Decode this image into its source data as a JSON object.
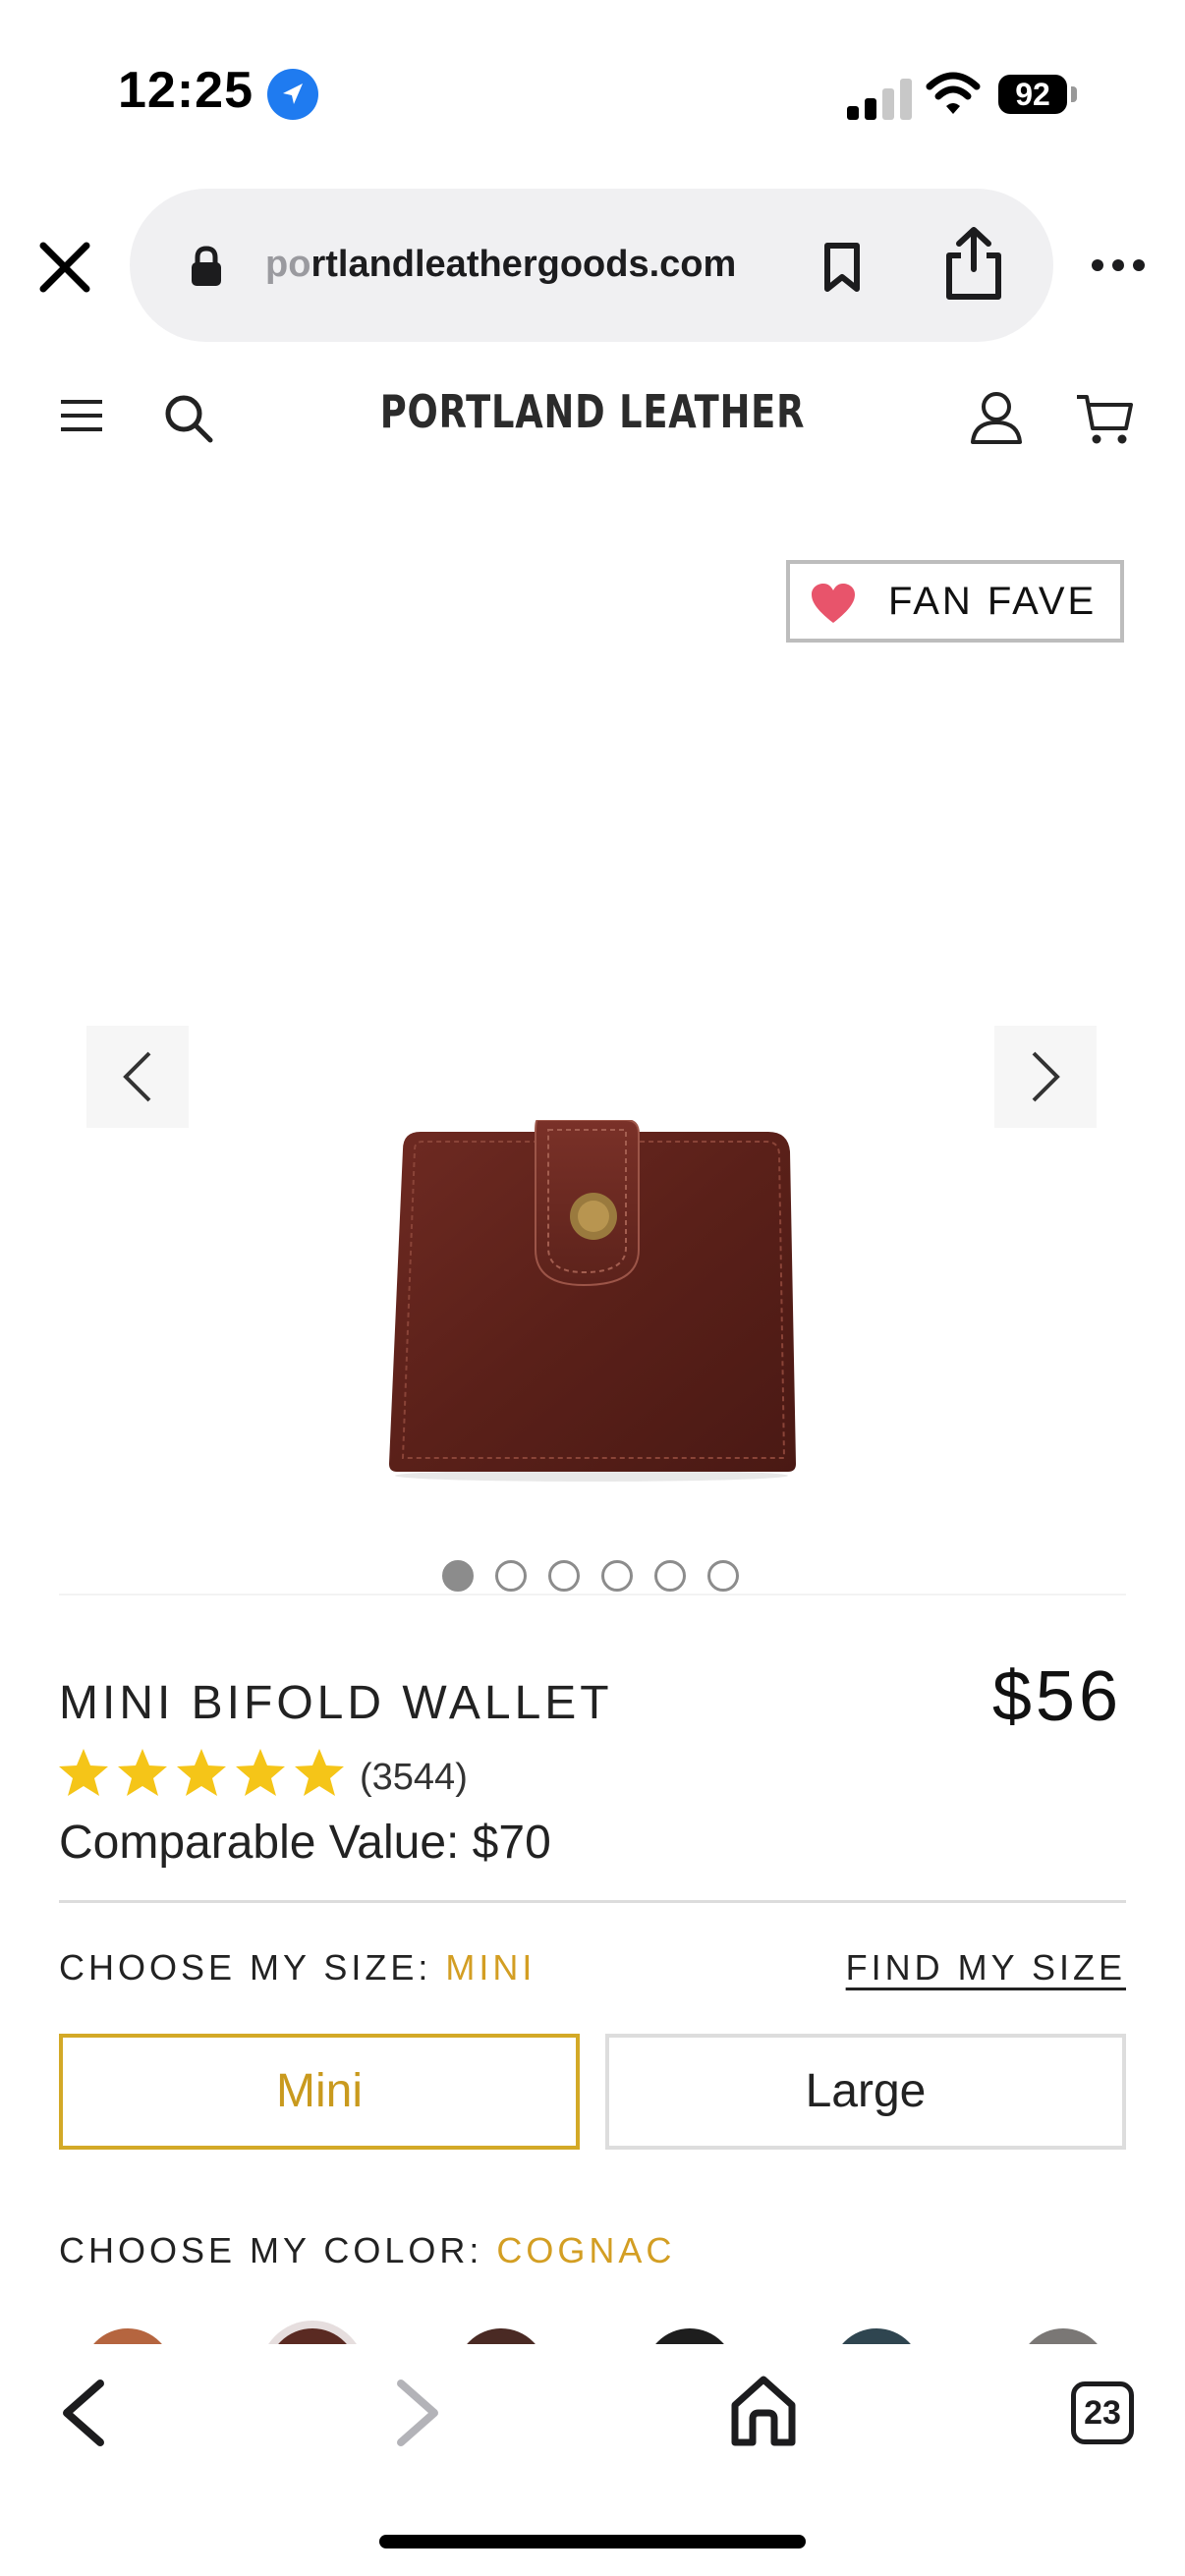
{
  "status_bar": {
    "time": "12:25",
    "battery": "92"
  },
  "browser": {
    "url_faded": "po",
    "url_main": "rtlandleathergoods.com",
    "tab_count": "23"
  },
  "site": {
    "logo": "PORTLAND LEATHER"
  },
  "product": {
    "badge": "FAN FAVE",
    "title": "MINI BIFOLD WALLET",
    "price": "$56",
    "rating_stars": 5,
    "review_count": "(3544)",
    "comparable_value": "Comparable Value: $70",
    "image_page": {
      "current": 1,
      "total": 6
    }
  },
  "size": {
    "label": "CHOOSE MY SIZE:",
    "selected": "MINI",
    "find_link": "FIND MY SIZE",
    "options": [
      "Mini",
      "Large"
    ]
  },
  "color": {
    "label": "CHOOSE MY COLOR:",
    "selected": "COGNAC",
    "swatches": [
      "#b5653f",
      "#5a2a22",
      "#4a2a24",
      "#1e1e1e",
      "#2f4550",
      "#7a7775"
    ]
  },
  "colors": {
    "accent": "#d39e23",
    "location_blue": "#1f7bf0",
    "star": "#f5c518",
    "heart": "#e8546b"
  }
}
